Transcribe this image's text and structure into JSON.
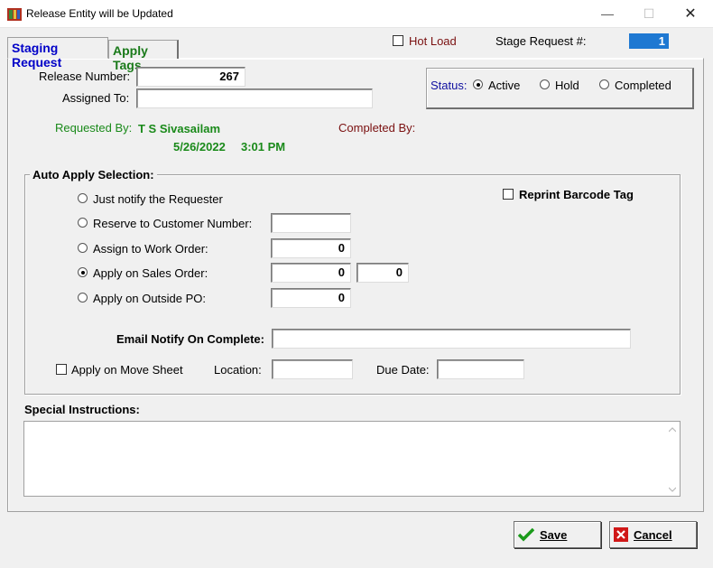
{
  "window": {
    "title": "Release Entity will be Updated",
    "minimize_glyph": "—",
    "maximize_glyph": "☐",
    "close_glyph": "✕"
  },
  "tabs": [
    {
      "label": "Staging Request",
      "active": true
    },
    {
      "label": "Apply Tags",
      "active": false
    }
  ],
  "header": {
    "hot_load_label": "Hot Load",
    "hot_load_checked": false,
    "stage_request_label": "Stage Request #:",
    "stage_request_value": "1"
  },
  "form": {
    "release_number_label": "Release Number:",
    "release_number_value": "267",
    "assigned_to_label": "Assigned To:",
    "assigned_to_value": "",
    "requested_by_label": "Requested By:",
    "requested_by_value": "T S Sivasailam",
    "requested_date": "5/26/2022",
    "requested_time": "3:01 PM",
    "completed_by_label": "Completed By:"
  },
  "status": {
    "label": "Status:",
    "options": [
      {
        "label": "Active",
        "selected": true
      },
      {
        "label": "Hold",
        "selected": false
      },
      {
        "label": "Completed",
        "selected": false
      }
    ]
  },
  "auto_apply": {
    "title": "Auto Apply Selection:",
    "reprint_label": "Reprint Barcode Tag",
    "options": [
      {
        "label": "Just notify the Requester",
        "selected": false
      },
      {
        "label": "Reserve to Customer Number:",
        "selected": false,
        "value": ""
      },
      {
        "label": "Assign to Work Order:",
        "selected": false,
        "value": "0"
      },
      {
        "label": "Apply on Sales Order:",
        "selected": true,
        "value": "0",
        "value2": "0"
      },
      {
        "label": "Apply on Outside PO:",
        "selected": false,
        "value": "0"
      }
    ],
    "email_label": "Email Notify On Complete:",
    "email_value": "",
    "move_sheet_label": "Apply on Move Sheet",
    "location_label": "Location:",
    "location_value": "",
    "due_date_label": "Due Date:",
    "due_date_value": ""
  },
  "special_instructions": {
    "label": "Special Instructions:",
    "value": ""
  },
  "buttons": {
    "save_label": "Save",
    "cancel_label": "Cancel"
  },
  "colors": {
    "active_tab": "#0000c8",
    "inactive_tab": "#1a7a1a",
    "requested_green": "#1a8a1a",
    "completed_red": "#7a1010",
    "status_blue": "#1010a0",
    "hot_load_red": "#7a1010",
    "stage_field_blue": "#1e78d2"
  }
}
